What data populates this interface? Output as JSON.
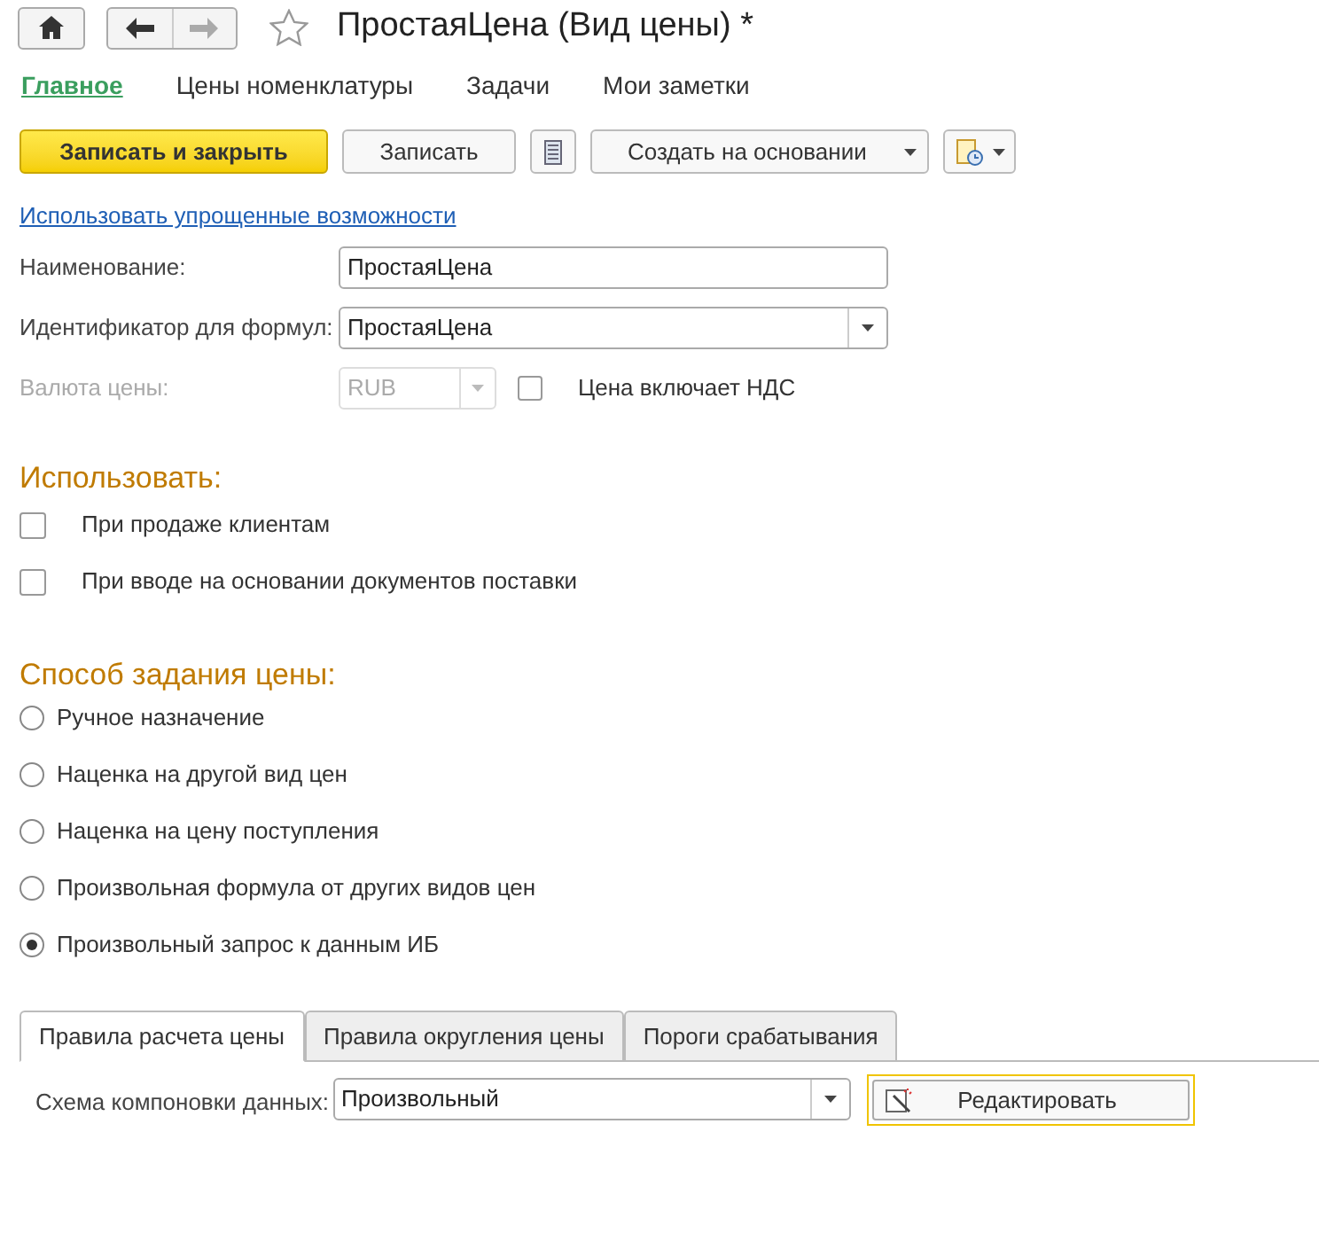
{
  "window": {
    "title": "ПростаяЦена (Вид цены) *"
  },
  "nav_tabs": [
    {
      "label": "Главное",
      "selected": true
    },
    {
      "label": "Цены номенклатуры",
      "selected": false
    },
    {
      "label": "Задачи",
      "selected": false
    },
    {
      "label": "Мои заметки",
      "selected": false
    }
  ],
  "toolbar": {
    "primary": "Записать и закрыть",
    "save": "Записать",
    "create_based": "Создать на основании"
  },
  "simplified_link": "Использовать упрощенные возможности",
  "fields": [
    {
      "label": "Наименование:",
      "value": "ПростаяЦена",
      "kind": "text"
    },
    {
      "label": "Идентификатор для формул:",
      "value": "ПростаяЦена",
      "kind": "dropdown"
    }
  ],
  "currency": {
    "label": "Валюта цены:",
    "value": "RUB",
    "disabled": true,
    "vat_label": "Цена включает НДС",
    "vat_checked": false
  },
  "use_section": {
    "title": "Использовать:",
    "options": [
      {
        "label": "При продаже клиентам",
        "checked": false
      },
      {
        "label": "При вводе на основании документов поставки",
        "checked": false
      }
    ]
  },
  "method_section": {
    "title": "Способ задания цены:",
    "options": [
      {
        "label": "Ручное назначение",
        "selected": false
      },
      {
        "label": "Наценка на другой вид цен",
        "selected": false
      },
      {
        "label": "Наценка на цену поступления",
        "selected": false
      },
      {
        "label": "Произвольная формула от других видов цен",
        "selected": false
      },
      {
        "label": "Произвольный запрос к данным ИБ",
        "selected": true
      }
    ]
  },
  "bottom_tabs": [
    {
      "label": "Правила расчета цены",
      "selected": true
    },
    {
      "label": "Правила округления цены",
      "selected": false
    },
    {
      "label": "Пороги срабатывания",
      "selected": false
    }
  ],
  "schema": {
    "label": "Схема компоновки данных:",
    "value": "Произвольный",
    "edit_button": "Редактировать"
  }
}
